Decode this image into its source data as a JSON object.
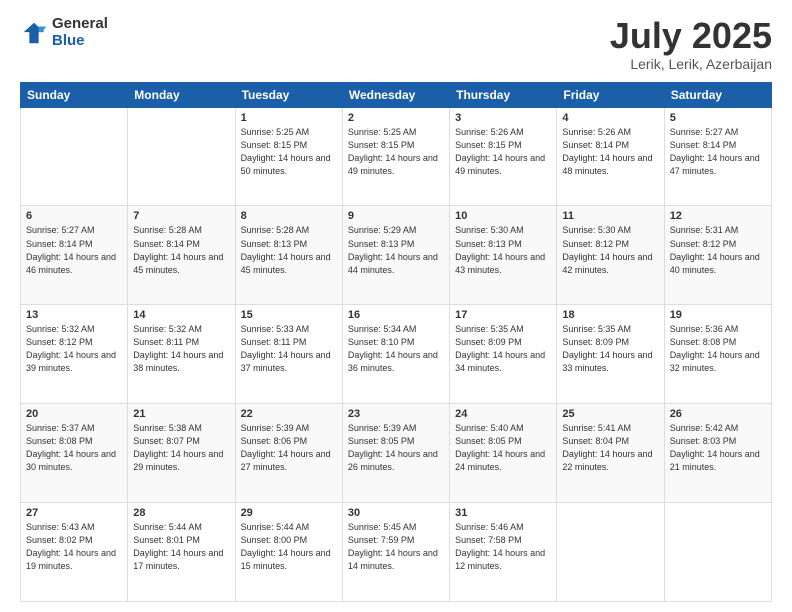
{
  "header": {
    "logo_general": "General",
    "logo_blue": "Blue",
    "title": "July 2025",
    "subtitle": "Lerik, Lerik, Azerbaijan"
  },
  "weekdays": [
    "Sunday",
    "Monday",
    "Tuesday",
    "Wednesday",
    "Thursday",
    "Friday",
    "Saturday"
  ],
  "weeks": [
    [
      {
        "day": null
      },
      {
        "day": null
      },
      {
        "day": "1",
        "sunrise": "Sunrise: 5:25 AM",
        "sunset": "Sunset: 8:15 PM",
        "daylight": "Daylight: 14 hours and 50 minutes."
      },
      {
        "day": "2",
        "sunrise": "Sunrise: 5:25 AM",
        "sunset": "Sunset: 8:15 PM",
        "daylight": "Daylight: 14 hours and 49 minutes."
      },
      {
        "day": "3",
        "sunrise": "Sunrise: 5:26 AM",
        "sunset": "Sunset: 8:15 PM",
        "daylight": "Daylight: 14 hours and 49 minutes."
      },
      {
        "day": "4",
        "sunrise": "Sunrise: 5:26 AM",
        "sunset": "Sunset: 8:14 PM",
        "daylight": "Daylight: 14 hours and 48 minutes."
      },
      {
        "day": "5",
        "sunrise": "Sunrise: 5:27 AM",
        "sunset": "Sunset: 8:14 PM",
        "daylight": "Daylight: 14 hours and 47 minutes."
      }
    ],
    [
      {
        "day": "6",
        "sunrise": "Sunrise: 5:27 AM",
        "sunset": "Sunset: 8:14 PM",
        "daylight": "Daylight: 14 hours and 46 minutes."
      },
      {
        "day": "7",
        "sunrise": "Sunrise: 5:28 AM",
        "sunset": "Sunset: 8:14 PM",
        "daylight": "Daylight: 14 hours and 45 minutes."
      },
      {
        "day": "8",
        "sunrise": "Sunrise: 5:28 AM",
        "sunset": "Sunset: 8:13 PM",
        "daylight": "Daylight: 14 hours and 45 minutes."
      },
      {
        "day": "9",
        "sunrise": "Sunrise: 5:29 AM",
        "sunset": "Sunset: 8:13 PM",
        "daylight": "Daylight: 14 hours and 44 minutes."
      },
      {
        "day": "10",
        "sunrise": "Sunrise: 5:30 AM",
        "sunset": "Sunset: 8:13 PM",
        "daylight": "Daylight: 14 hours and 43 minutes."
      },
      {
        "day": "11",
        "sunrise": "Sunrise: 5:30 AM",
        "sunset": "Sunset: 8:12 PM",
        "daylight": "Daylight: 14 hours and 42 minutes."
      },
      {
        "day": "12",
        "sunrise": "Sunrise: 5:31 AM",
        "sunset": "Sunset: 8:12 PM",
        "daylight": "Daylight: 14 hours and 40 minutes."
      }
    ],
    [
      {
        "day": "13",
        "sunrise": "Sunrise: 5:32 AM",
        "sunset": "Sunset: 8:12 PM",
        "daylight": "Daylight: 14 hours and 39 minutes."
      },
      {
        "day": "14",
        "sunrise": "Sunrise: 5:32 AM",
        "sunset": "Sunset: 8:11 PM",
        "daylight": "Daylight: 14 hours and 38 minutes."
      },
      {
        "day": "15",
        "sunrise": "Sunrise: 5:33 AM",
        "sunset": "Sunset: 8:11 PM",
        "daylight": "Daylight: 14 hours and 37 minutes."
      },
      {
        "day": "16",
        "sunrise": "Sunrise: 5:34 AM",
        "sunset": "Sunset: 8:10 PM",
        "daylight": "Daylight: 14 hours and 36 minutes."
      },
      {
        "day": "17",
        "sunrise": "Sunrise: 5:35 AM",
        "sunset": "Sunset: 8:09 PM",
        "daylight": "Daylight: 14 hours and 34 minutes."
      },
      {
        "day": "18",
        "sunrise": "Sunrise: 5:35 AM",
        "sunset": "Sunset: 8:09 PM",
        "daylight": "Daylight: 14 hours and 33 minutes."
      },
      {
        "day": "19",
        "sunrise": "Sunrise: 5:36 AM",
        "sunset": "Sunset: 8:08 PM",
        "daylight": "Daylight: 14 hours and 32 minutes."
      }
    ],
    [
      {
        "day": "20",
        "sunrise": "Sunrise: 5:37 AM",
        "sunset": "Sunset: 8:08 PM",
        "daylight": "Daylight: 14 hours and 30 minutes."
      },
      {
        "day": "21",
        "sunrise": "Sunrise: 5:38 AM",
        "sunset": "Sunset: 8:07 PM",
        "daylight": "Daylight: 14 hours and 29 minutes."
      },
      {
        "day": "22",
        "sunrise": "Sunrise: 5:39 AM",
        "sunset": "Sunset: 8:06 PM",
        "daylight": "Daylight: 14 hours and 27 minutes."
      },
      {
        "day": "23",
        "sunrise": "Sunrise: 5:39 AM",
        "sunset": "Sunset: 8:05 PM",
        "daylight": "Daylight: 14 hours and 26 minutes."
      },
      {
        "day": "24",
        "sunrise": "Sunrise: 5:40 AM",
        "sunset": "Sunset: 8:05 PM",
        "daylight": "Daylight: 14 hours and 24 minutes."
      },
      {
        "day": "25",
        "sunrise": "Sunrise: 5:41 AM",
        "sunset": "Sunset: 8:04 PM",
        "daylight": "Daylight: 14 hours and 22 minutes."
      },
      {
        "day": "26",
        "sunrise": "Sunrise: 5:42 AM",
        "sunset": "Sunset: 8:03 PM",
        "daylight": "Daylight: 14 hours and 21 minutes."
      }
    ],
    [
      {
        "day": "27",
        "sunrise": "Sunrise: 5:43 AM",
        "sunset": "Sunset: 8:02 PM",
        "daylight": "Daylight: 14 hours and 19 minutes."
      },
      {
        "day": "28",
        "sunrise": "Sunrise: 5:44 AM",
        "sunset": "Sunset: 8:01 PM",
        "daylight": "Daylight: 14 hours and 17 minutes."
      },
      {
        "day": "29",
        "sunrise": "Sunrise: 5:44 AM",
        "sunset": "Sunset: 8:00 PM",
        "daylight": "Daylight: 14 hours and 15 minutes."
      },
      {
        "day": "30",
        "sunrise": "Sunrise: 5:45 AM",
        "sunset": "Sunset: 7:59 PM",
        "daylight": "Daylight: 14 hours and 14 minutes."
      },
      {
        "day": "31",
        "sunrise": "Sunrise: 5:46 AM",
        "sunset": "Sunset: 7:58 PM",
        "daylight": "Daylight: 14 hours and 12 minutes."
      },
      {
        "day": null
      },
      {
        "day": null
      }
    ]
  ]
}
